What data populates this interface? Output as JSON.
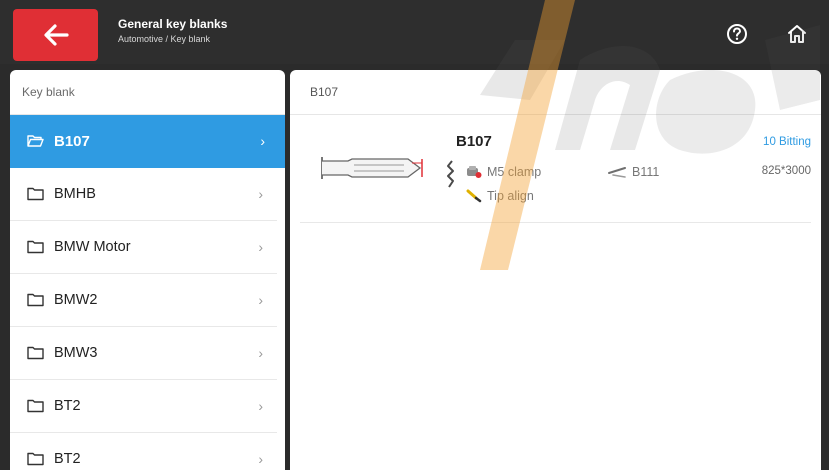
{
  "header": {
    "title": "General key blanks",
    "breadcrumb": "Automotive / Key blank",
    "back_icon": "arrow-left-icon",
    "help_icon": "help-circle-icon",
    "home_icon": "home-icon",
    "accent_color": "#e02f35"
  },
  "sidebar": {
    "heading": "Key blank",
    "items": [
      {
        "label": "B107",
        "selected": true
      },
      {
        "label": "BMHB",
        "selected": false
      },
      {
        "label": "BMW Motor",
        "selected": false
      },
      {
        "label": "BMW2",
        "selected": false
      },
      {
        "label": "BMW3",
        "selected": false
      },
      {
        "label": "BT2",
        "selected": false
      },
      {
        "label": "BT2",
        "selected": false
      }
    ],
    "selected_color": "#2f9be2"
  },
  "detail": {
    "heading": "B107",
    "key": {
      "name": "B107",
      "bitting": "10 Bitting",
      "size": "825*3000",
      "clamp": "M5 clamp",
      "alt_key": "B111",
      "tip": "Tip align"
    }
  }
}
